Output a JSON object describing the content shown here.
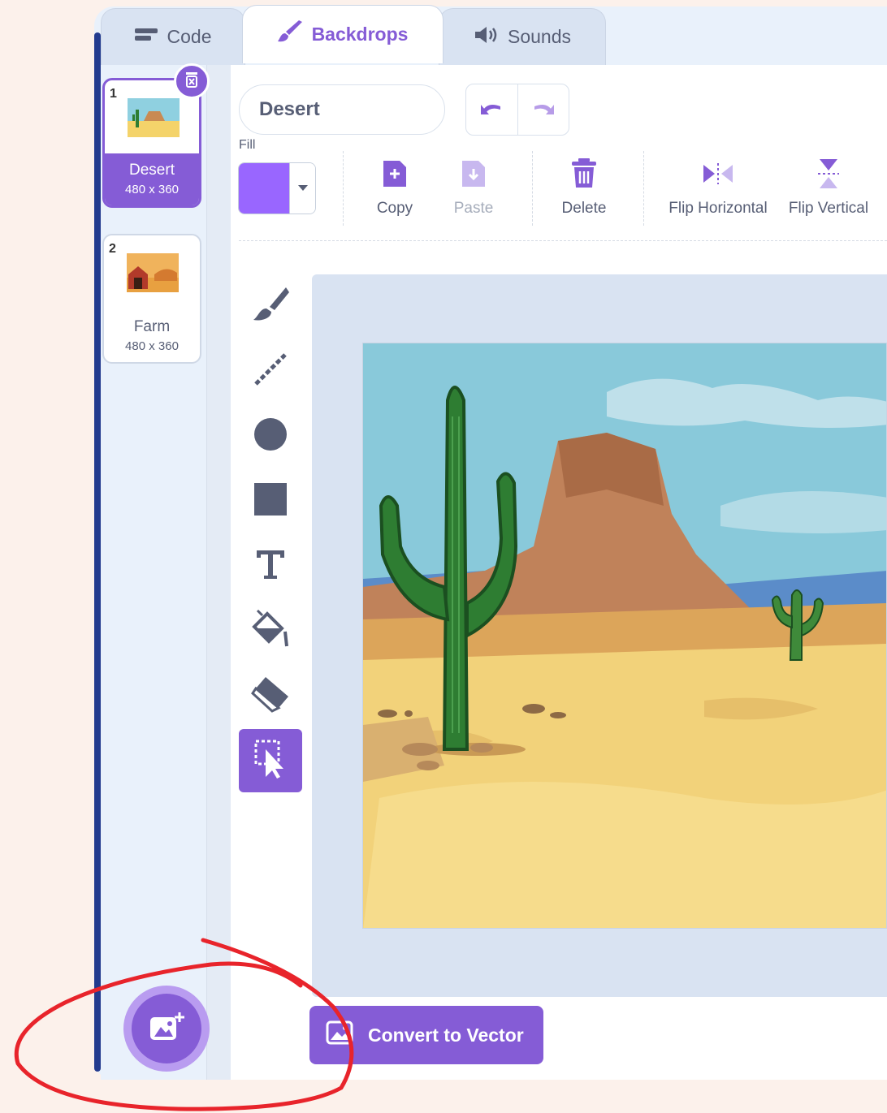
{
  "tabs": {
    "code": "Code",
    "backdrops": "Backdrops",
    "sounds": "Sounds"
  },
  "backdrops": [
    {
      "number": "1",
      "name": "Desert",
      "size": "480 x 360",
      "selected": true
    },
    {
      "number": "2",
      "name": "Farm",
      "size": "480 x 360",
      "selected": false
    }
  ],
  "editor": {
    "backdrop_name": "Desert",
    "fill_label": "Fill",
    "fill_color": "#9966ff",
    "copy_label": "Copy",
    "paste_label": "Paste",
    "delete_label": "Delete",
    "flip_horizontal_label": "Flip Horizontal",
    "flip_vertical_label": "Flip Vertical",
    "convert_label": "Convert to Vector"
  },
  "tools": [
    "brush-icon",
    "line-icon",
    "circle-icon",
    "rectangle-icon",
    "text-icon",
    "fill-bucket-icon",
    "eraser-icon",
    "select-icon"
  ],
  "active_tool": "select-icon",
  "colors": {
    "accent": "#855cd6",
    "annotation": "#e8242b"
  }
}
